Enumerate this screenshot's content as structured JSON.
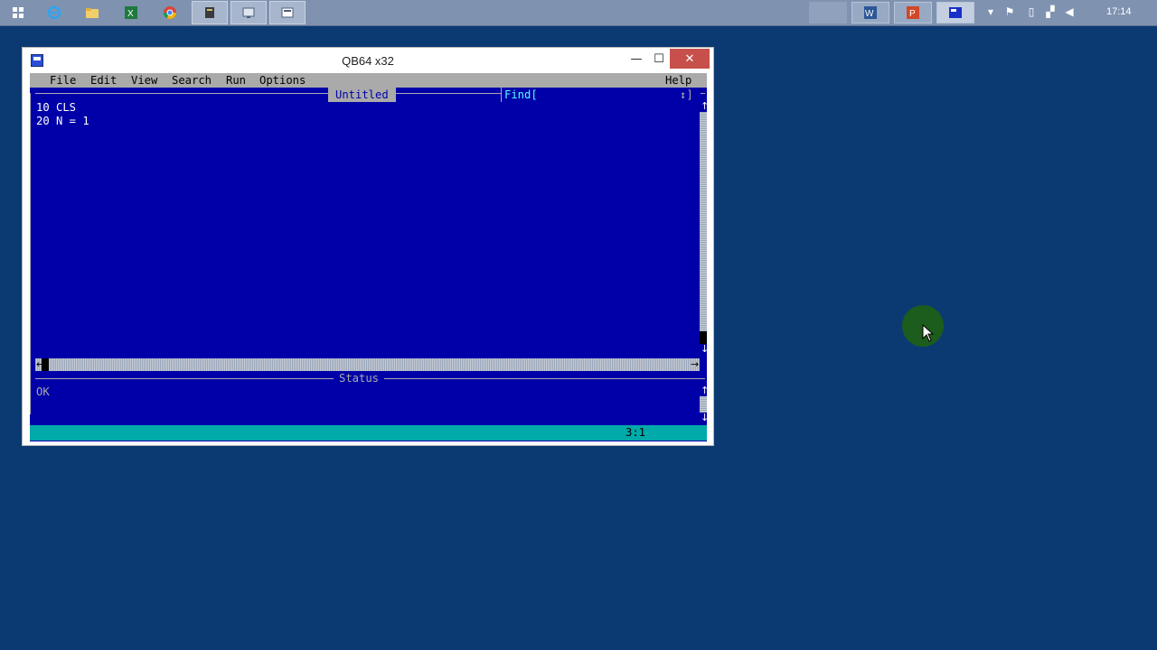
{
  "taskbar": {
    "apps": [
      {
        "name": "start-icon"
      },
      {
        "name": "internet-explorer-icon"
      },
      {
        "name": "file-explorer-icon"
      },
      {
        "name": "excel-icon"
      },
      {
        "name": "chrome-icon"
      },
      {
        "name": "app-icon"
      },
      {
        "name": "remote-desktop-icon"
      },
      {
        "name": "qb64-taskbar-icon"
      }
    ],
    "clock": "17:14"
  },
  "window": {
    "title": "QB64 x32",
    "controls": {
      "minimize": "—",
      "maximize": "☐",
      "close": "✕"
    }
  },
  "ide": {
    "menu": [
      "File",
      "Edit",
      "View",
      "Search",
      "Run",
      "Options"
    ],
    "help": "Help",
    "doc_title": "Untitled",
    "find_label": "Find[",
    "find_arrows": "↕]",
    "code": [
      "10 CLS",
      "20 N = 1"
    ],
    "status_title": "Status",
    "status_text": "OK",
    "cursor_position": "3:1"
  },
  "colors": {
    "desktop": "#0b3a72",
    "console_bg": "#0000a8",
    "menu_bg": "#aaaaaa",
    "status_bar_bg": "#00aaaa",
    "close_button": "#c7504b"
  }
}
